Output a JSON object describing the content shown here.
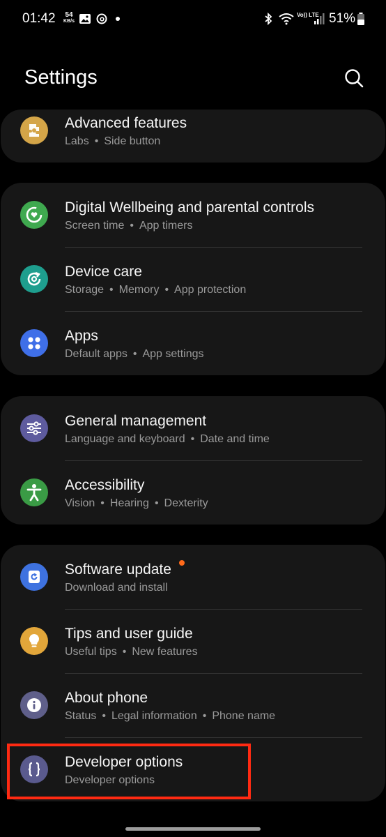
{
  "status_bar": {
    "time": "01:42",
    "net_speed_value": "54",
    "net_speed_unit": "KB/s",
    "volte": "Vo)) LTE",
    "battery_percent": "51%"
  },
  "header": {
    "title": "Settings",
    "search_icon": "search-icon"
  },
  "groups": [
    {
      "items": [
        {
          "title": "Advanced features",
          "subtitle": [
            "Labs",
            "Side button"
          ],
          "icon": "puzzle-icon",
          "color": "#d4a548"
        }
      ]
    },
    {
      "items": [
        {
          "title": "Digital Wellbeing and parental controls",
          "subtitle": [
            "Screen time",
            "App timers"
          ],
          "icon": "heart-ring-icon",
          "color": "#3fa94f"
        },
        {
          "title": "Device care",
          "subtitle": [
            "Storage",
            "Memory",
            "App protection"
          ],
          "icon": "refresh-care-icon",
          "color": "#1e9e8e"
        },
        {
          "title": "Apps",
          "subtitle": [
            "Default apps",
            "App settings"
          ],
          "icon": "apps-grid-icon",
          "color": "#3f6fe8"
        }
      ]
    },
    {
      "items": [
        {
          "title": "General management",
          "subtitle": [
            "Language and keyboard",
            "Date and time"
          ],
          "icon": "sliders-icon",
          "color": "#5e5b9e"
        },
        {
          "title": "Accessibility",
          "subtitle": [
            "Vision",
            "Hearing",
            "Dexterity"
          ],
          "icon": "accessibility-person-icon",
          "color": "#3a9b45"
        }
      ]
    },
    {
      "items": [
        {
          "title": "Software update",
          "subtitle": [
            "Download and install"
          ],
          "icon": "update-icon",
          "color": "#3e72e0",
          "badge": true
        },
        {
          "title": "Tips and user guide",
          "subtitle": [
            "Useful tips",
            "New features"
          ],
          "icon": "lightbulb-icon",
          "color": "#e2a63a"
        },
        {
          "title": "About phone",
          "subtitle": [
            "Status",
            "Legal information",
            "Phone name"
          ],
          "icon": "info-icon",
          "color": "#5f5f8a"
        },
        {
          "title": "Developer options",
          "subtitle": [
            "Developer options"
          ],
          "icon": "code-braces-icon",
          "color": "#5a5a8e"
        }
      ]
    }
  ],
  "colors": {
    "background": "#000000",
    "card": "#171717",
    "highlight": "#ff2a12",
    "badge": "#ff6a1a"
  }
}
